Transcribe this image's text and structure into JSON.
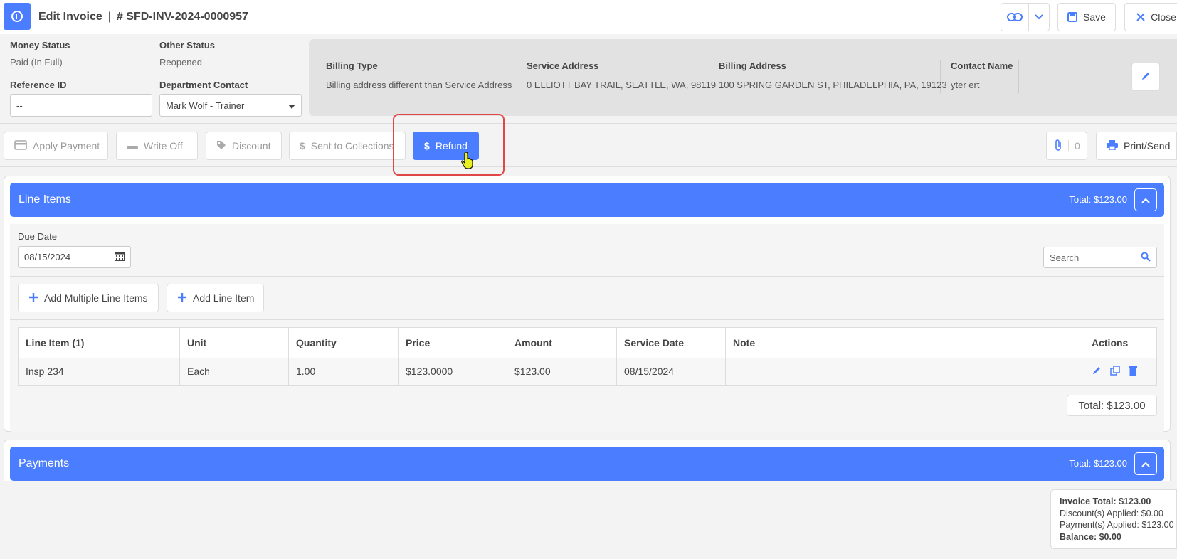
{
  "header": {
    "title": "Edit Invoice",
    "separator": "|",
    "invoice_number": "# SFD-INV-2024-0000957",
    "save_label": "Save",
    "close_label": "Close"
  },
  "status": {
    "money_status_label": "Money Status",
    "money_status_value": "Paid (In Full)",
    "other_status_label": "Other Status",
    "other_status_value": "Reopened",
    "reference_id_label": "Reference ID",
    "reference_id_value": "--",
    "dept_contact_label": "Department Contact",
    "dept_contact_value": "Mark Wolf - Trainer"
  },
  "billing": {
    "billing_type_label": "Billing Type",
    "billing_type_value": "Billing address different than Service Address",
    "service_address_label": "Service Address",
    "service_address_value": "0 ELLIOTT BAY TRAIL, SEATTLE, WA, 98119",
    "billing_address_label": "Billing Address",
    "billing_address_value": "100 SPRING GARDEN ST, PHILADELPHIA, PA, 19123",
    "contact_name_label": "Contact Name",
    "contact_name_value": "yter ert"
  },
  "actions": {
    "apply_payment": "Apply Payment",
    "write_off": "Write Off",
    "discount": "Discount",
    "sent_to_collections": "Sent to Collections",
    "refund": "Refund",
    "attachment_count": "0",
    "print_send": "Print/Send"
  },
  "line_items": {
    "title": "Line Items",
    "total_label": "Total: $123.00",
    "due_date_label": "Due Date",
    "due_date_value": "08/15/2024",
    "search_placeholder": "Search",
    "add_multiple_label": "Add Multiple Line Items",
    "add_single_label": "Add Line Item",
    "columns": [
      "Line Item (1)",
      "Unit",
      "Quantity",
      "Price",
      "Amount",
      "Service Date",
      "Note",
      "Actions"
    ],
    "rows": [
      {
        "line_item": "Insp 234",
        "unit": "Each",
        "quantity": "1.00",
        "price": "$123.0000",
        "amount": "$123.00",
        "service_date": "08/15/2024",
        "note": ""
      }
    ],
    "table_total": "Total: $123.00"
  },
  "payments": {
    "title": "Payments",
    "total_label": "Total: $123.00"
  },
  "summary": {
    "invoice_total": "Invoice Total: $123.00",
    "discounts_applied": "Discount(s) Applied: $0.00",
    "payments_applied": "Payment(s) Applied: $123.00",
    "balance": "Balance: $0.00"
  },
  "colors": {
    "accent": "#4a7dff",
    "highlight": "#e04848"
  }
}
